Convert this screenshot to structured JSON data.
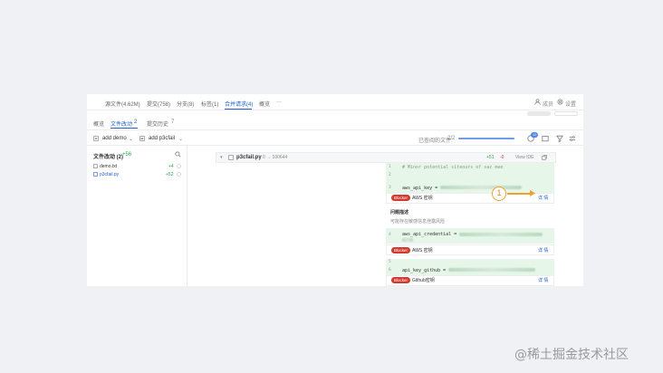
{
  "top_tabs": [
    {
      "label": "源文件(4.62M)"
    },
    {
      "label": "提交(758)"
    },
    {
      "label": "分支(8)"
    },
    {
      "label": "标签(1)"
    },
    {
      "label": "合并请求(4)"
    },
    {
      "label": "概览"
    },
    {
      "label": "···"
    }
  ],
  "header_right": {
    "members": "成员",
    "settings": "设置"
  },
  "sub_tabs": [
    {
      "label": "概览"
    },
    {
      "label": "文件改动",
      "count": "2"
    },
    {
      "label": "提交历史",
      "count": "7"
    }
  ],
  "branches": {
    "source": "add demo",
    "target": "add p3cfail"
  },
  "progress": {
    "label": "已查阅的文件:",
    "value": "2/2",
    "fraction": 1.0
  },
  "notification_count": "12",
  "file_list": {
    "title": "文件改动 (2)",
    "total": "+56",
    "files": [
      {
        "name": "demo.txt",
        "delta": "+4"
      },
      {
        "name": "p3cfail.py",
        "delta": "+52"
      }
    ]
  },
  "diff": {
    "file_name": "p3cfail.py",
    "mode": "0 → 100644",
    "added": "+51",
    "removed": "-0",
    "view_ide": "View IDE",
    "lines": [
      {
        "num": "1",
        "text": "# Minor potential siteours of sac mee"
      },
      {
        "num": "2",
        "text": ""
      },
      {
        "num": "3",
        "text": ""
      },
      {
        "num": "3",
        "text": "aws_api_key = "
      }
    ],
    "line_4": {
      "num": "4",
      "text": "aws_api_credential = "
    },
    "line_5": {
      "num": "5",
      "text": ""
    },
    "line_6": {
      "num": "6",
      "text": "api_key_github = "
    }
  },
  "issues": [
    {
      "severity": "Blocker",
      "title": "AWS 密钥",
      "action": "详 情"
    },
    {
      "severity": "Blocker",
      "title": "AWS 密钥",
      "action": "详 情"
    },
    {
      "severity": "Blocker",
      "title": "Github密钥",
      "action": "详 情"
    }
  ],
  "problem": {
    "heading": "问题描述",
    "description": "可能存在敏感信息泄露风险"
  },
  "annotation": {
    "number": "1"
  },
  "watermark": "@稀土掘金技术社区"
}
